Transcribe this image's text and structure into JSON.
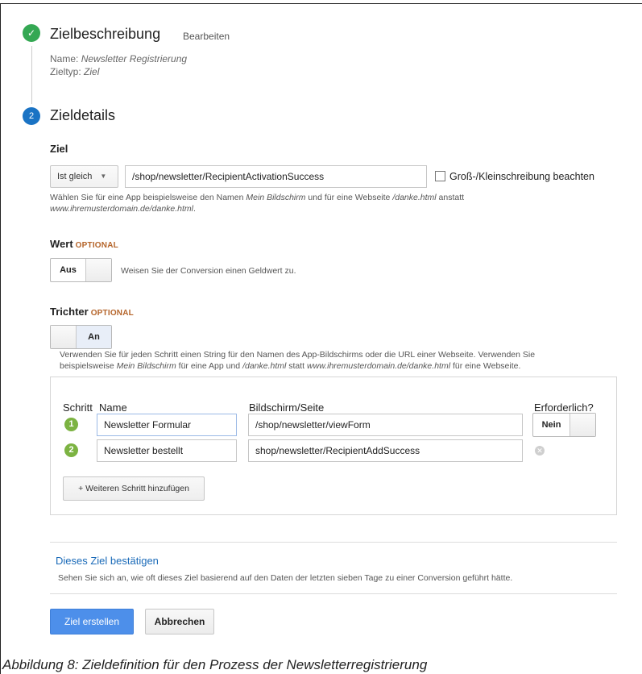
{
  "section1": {
    "title": "Zielbeschreibung",
    "edit_link": "Bearbeiten",
    "name_label": "Name:",
    "name_value": "Newsletter Registrierung",
    "type_label": "Zieltyp:",
    "type_value": "Ziel"
  },
  "section2": {
    "number": "2",
    "title": "Zieldetails"
  },
  "goal": {
    "label": "Ziel",
    "match_type": "Ist gleich",
    "url_value": "/shop/newsletter/RecipientActivationSuccess",
    "case_sensitive_label": "Groß-/Kleinschreibung beachten",
    "help_1": "Wählen Sie für eine App beispielsweise den Namen ",
    "help_app": "Mein Bildschirm",
    "help_2": " und für eine Webseite ",
    "help_page": "/danke.html",
    "help_3": " anstatt",
    "help_domain": "www.ihremusterdomain.de/danke.html",
    "help_4": "."
  },
  "value": {
    "label": "Wert",
    "optional": "OPTIONAL",
    "toggle_label": "Aus",
    "help": "Weisen Sie der Conversion einen Geldwert zu."
  },
  "funnel": {
    "label": "Trichter",
    "optional": "OPTIONAL",
    "toggle_label": "An",
    "help_1": "Verwenden Sie für jeden Schritt einen String für den Namen des App-Bildschirms oder die URL einer Webseite. Verwenden Sie",
    "help_2a": "beispielsweise ",
    "help_app": "Mein Bildschirm",
    "help_2b": " für eine App und ",
    "help_page": "/danke.html",
    "help_2c": " statt ",
    "help_domain": "www.ihremusterdomain.de/danke.html",
    "help_2d": " für eine Webseite.",
    "col_step": "Schritt",
    "col_name": "Name",
    "col_screen": "Bildschirm/Seite",
    "col_required": "Erforderlich?",
    "steps": [
      {
        "num": "1",
        "name": "Newsletter Formular",
        "screen": "/shop/newsletter/viewForm"
      },
      {
        "num": "2",
        "name": "Newsletter bestellt",
        "screen": "shop/newsletter/RecipientAddSuccess"
      }
    ],
    "required_toggle": "Nein",
    "add_step": "+ Weiteren Schritt hinzufügen"
  },
  "verify": {
    "link": "Dieses Ziel bestätigen",
    "help": "Sehen Sie sich an, wie oft dieses Ziel basierend auf den Daten der letzten sieben Tage zu einer Conversion geführt hätte."
  },
  "actions": {
    "create": "Ziel erstellen",
    "cancel": "Abbrechen"
  },
  "caption": "Abbildung 8: Zieldefinition für den Prozess der Newsletterregistrierung",
  "colors": {
    "check_green": "#34a853",
    "step_blue": "#1a73c4",
    "optional_orange": "#b5652b",
    "primary_button": "#4d8fea",
    "link_blue": "#1a6ab8",
    "funnel_step_green": "#7cb342"
  }
}
